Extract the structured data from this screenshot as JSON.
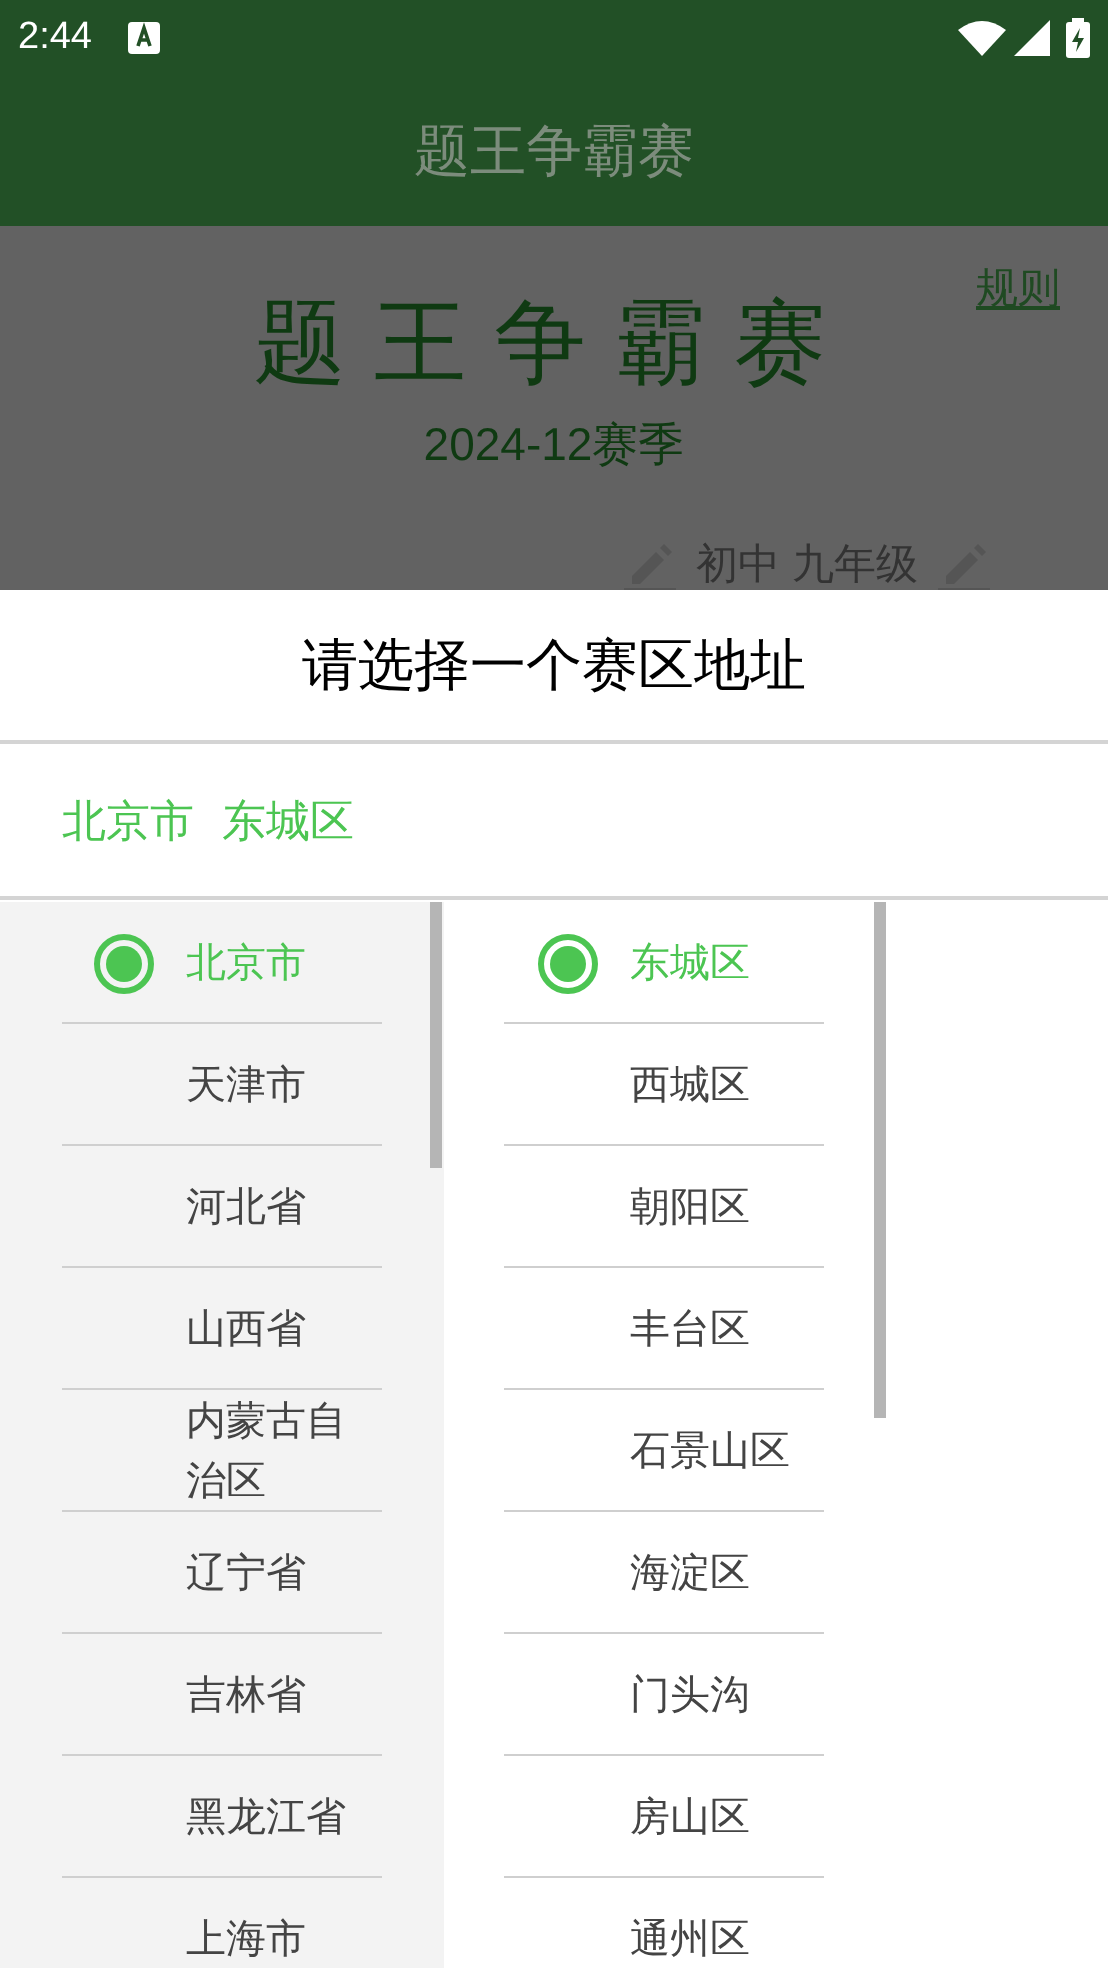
{
  "status_bar": {
    "time": "2:44"
  },
  "app_bar": {
    "title": "题王争霸赛"
  },
  "header": {
    "title": "题王争霸赛",
    "season": "2024-12赛季",
    "rules_link": "规则",
    "grade": "初中 九年级"
  },
  "dialog": {
    "title": "请选择一个赛区地址",
    "selection": [
      "北京市",
      "东城区"
    ],
    "provinces": [
      {
        "name": "北京市",
        "selected": true
      },
      {
        "name": "天津市",
        "selected": false
      },
      {
        "name": "河北省",
        "selected": false
      },
      {
        "name": "山西省",
        "selected": false
      },
      {
        "name": "内蒙古自治区",
        "selected": false
      },
      {
        "name": "辽宁省",
        "selected": false
      },
      {
        "name": "吉林省",
        "selected": false
      },
      {
        "name": "黑龙江省",
        "selected": false
      },
      {
        "name": "上海市",
        "selected": false
      }
    ],
    "districts": [
      {
        "name": "东城区",
        "selected": true
      },
      {
        "name": "西城区",
        "selected": false
      },
      {
        "name": "朝阳区",
        "selected": false
      },
      {
        "name": "丰台区",
        "selected": false
      },
      {
        "name": "石景山区",
        "selected": false
      },
      {
        "name": "海淀区",
        "selected": false
      },
      {
        "name": "门头沟",
        "selected": false
      },
      {
        "name": "房山区",
        "selected": false
      },
      {
        "name": "通州区",
        "selected": false
      }
    ]
  }
}
